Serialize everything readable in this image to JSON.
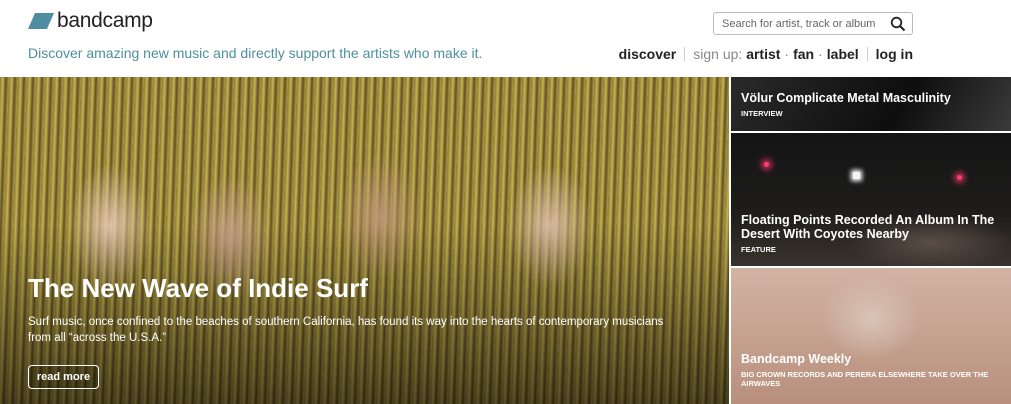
{
  "header": {
    "logo_text": "bandcamp",
    "tagline": "Discover amazing new music and directly support the artists who make it.",
    "search": {
      "placeholder": "Search for artist, track or album"
    },
    "nav": {
      "discover": "discover",
      "signup_label": "sign up:",
      "artist": "artist",
      "fan": "fan",
      "label": "label",
      "login": "log in"
    }
  },
  "hero": {
    "title": "The New Wave of Indie Surf",
    "description": "Surf music, once confined to the beaches of southern California, has found its way into the hearts of contemporary musicians from all “across the U.S.A.”",
    "button_label": "read more"
  },
  "side_features": [
    {
      "title": "Völur Complicate Metal Masculinity",
      "category": "INTERVIEW"
    },
    {
      "title": "Floating Points Recorded An Album In The Desert With Coyotes Nearby",
      "category": "FEATURE"
    },
    {
      "title": "Bandcamp Weekly",
      "category": "BIG CROWN RECORDS AND PERERA ELSEWHERE TAKE OVER THE AIRWAVES"
    }
  ],
  "colors": {
    "logo_teal": "#4f8ea0",
    "tagline": "#4e8f9d"
  }
}
